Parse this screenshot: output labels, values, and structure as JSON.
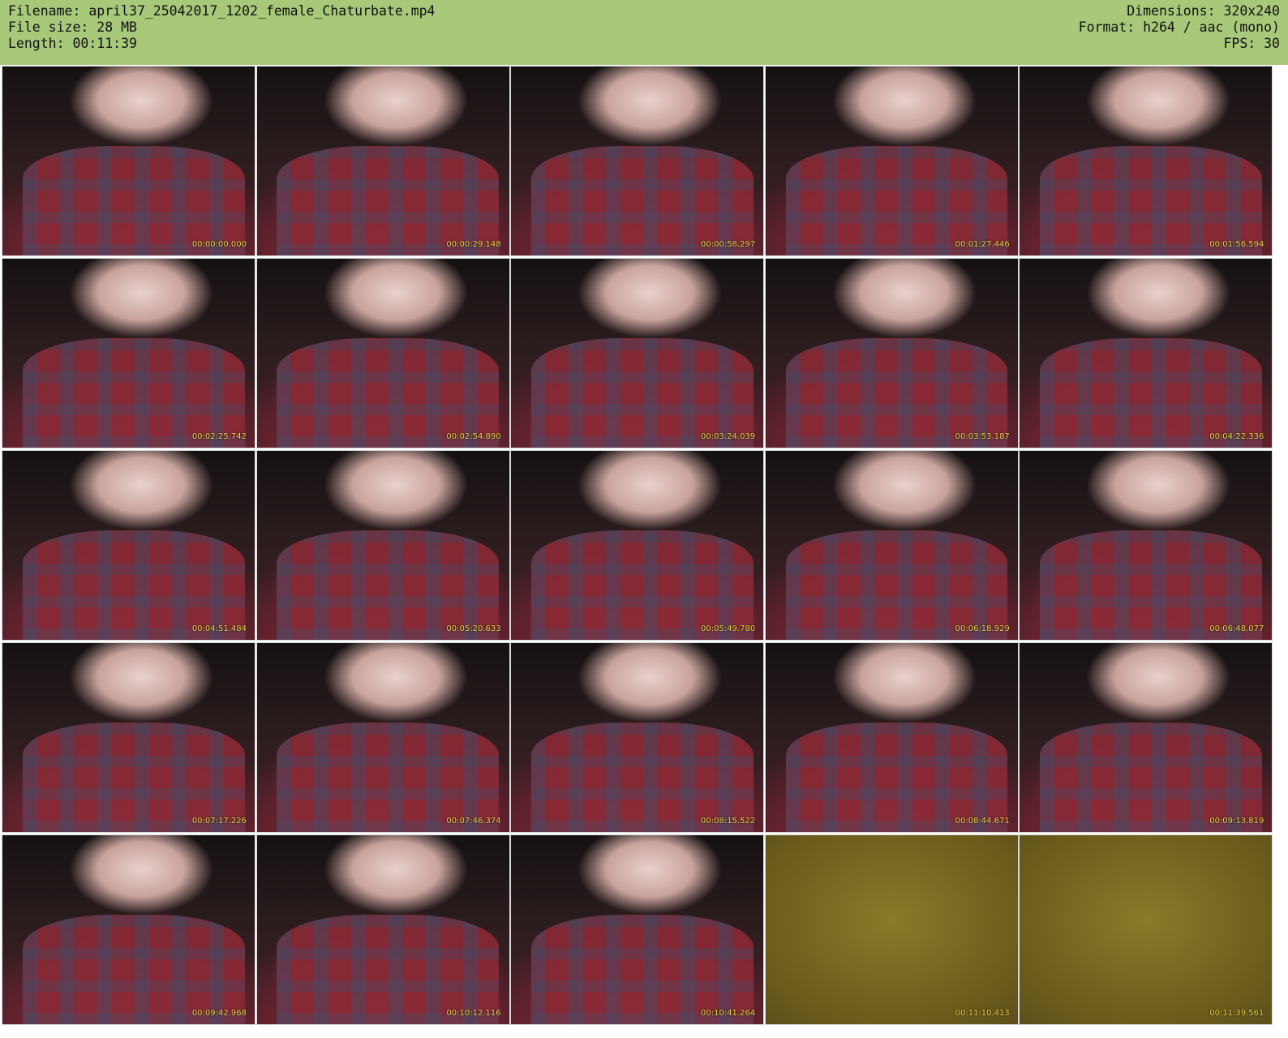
{
  "header": {
    "filename_line": "Filename: april37_25042017_1202_female_Chaturbate.mp4",
    "filesize_line": "File size: 28 MB",
    "length_line": "Length: 00:11:39",
    "dimensions_line": "Dimensions: 320x240",
    "format_line": "Format: h264 / aac (mono)",
    "fps_line": "FPS: 30",
    "background_color": "#a8c87a"
  },
  "thumbnails": [
    {
      "timestamp": "00:00:00.000",
      "tone": "scene"
    },
    {
      "timestamp": "00:00:29.148",
      "tone": "scene"
    },
    {
      "timestamp": "00:00:58.297",
      "tone": "scene"
    },
    {
      "timestamp": "00:01:27.446",
      "tone": "scene"
    },
    {
      "timestamp": "00:01:56.594",
      "tone": "scene"
    },
    {
      "timestamp": "00:02:25.742",
      "tone": "scene"
    },
    {
      "timestamp": "00:02:54.890",
      "tone": "scene"
    },
    {
      "timestamp": "00:03:24.039",
      "tone": "scene"
    },
    {
      "timestamp": "00:03:53.187",
      "tone": "scene"
    },
    {
      "timestamp": "00:04:22.336",
      "tone": "scene"
    },
    {
      "timestamp": "00:04:51.484",
      "tone": "scene"
    },
    {
      "timestamp": "00:05:20.633",
      "tone": "scene"
    },
    {
      "timestamp": "00:05:49.780",
      "tone": "scene"
    },
    {
      "timestamp": "00:06:18.929",
      "tone": "scene"
    },
    {
      "timestamp": "00:06:48.077",
      "tone": "scene"
    },
    {
      "timestamp": "00:07:17.226",
      "tone": "scene"
    },
    {
      "timestamp": "00:07:46.374",
      "tone": "scene"
    },
    {
      "timestamp": "00:08:15.522",
      "tone": "scene"
    },
    {
      "timestamp": "00:08:44.671",
      "tone": "scene"
    },
    {
      "timestamp": "00:09:13.819",
      "tone": "scene"
    },
    {
      "timestamp": "00:09:42.968",
      "tone": "scene"
    },
    {
      "timestamp": "00:10:12.116",
      "tone": "scene"
    },
    {
      "timestamp": "00:10:41.264",
      "tone": "scene"
    },
    {
      "timestamp": "00:11:10.413",
      "tone": "olive"
    },
    {
      "timestamp": "00:11:39.561",
      "tone": "olive"
    }
  ]
}
